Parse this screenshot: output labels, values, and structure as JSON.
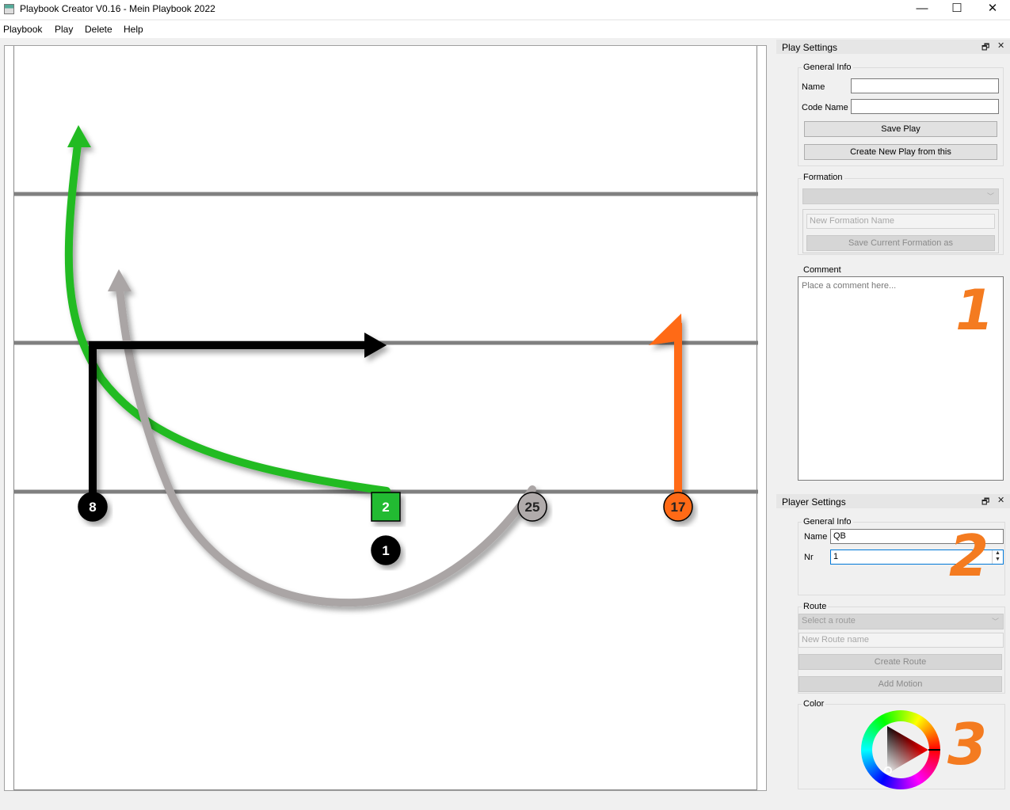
{
  "window": {
    "title": "Playbook Creator V0.16 - Mein Playbook 2022",
    "minimize": "—",
    "maximize": "☐",
    "close": "✕"
  },
  "menu": [
    "Playbook",
    "Play",
    "Delete",
    "Help"
  ],
  "field": {
    "yard_lines": 3,
    "players": [
      {
        "label": "8",
        "shape": "circle",
        "color": "#000000",
        "text_color": "#ffffff"
      },
      {
        "label": "2",
        "shape": "square",
        "color": "#22bb33",
        "text_color": "#ffffff"
      },
      {
        "label": "25",
        "shape": "circle",
        "color": "#b0abab",
        "text_color": "#222222"
      },
      {
        "label": "17",
        "shape": "circle",
        "color": "#ff6a13",
        "text_color": "#222222"
      },
      {
        "label": "1",
        "shape": "circle",
        "color": "#000000",
        "text_color": "#ffffff"
      }
    ],
    "route_colors": {
      "black": "#000000",
      "green": "#22bb22",
      "gray": "#aaa5a5",
      "orange": "#ff6a13"
    }
  },
  "play_settings": {
    "panel_title": "Play Settings",
    "float_icon": "🗗",
    "close_icon": "✕",
    "general_info": "General Info",
    "name_label": "Name",
    "name_value": "",
    "code_name_label": "Code Name",
    "code_name_value": "",
    "save_play": "Save Play",
    "create_new_play": "Create New Play from this",
    "formation_label": "Formation",
    "formation_selected": "",
    "new_formation_placeholder": "New Formation Name",
    "save_formation": "Save Current Formation as",
    "comment_label": "Comment",
    "comment_placeholder": "Place a comment here..."
  },
  "player_settings": {
    "panel_title": "Player Settings",
    "float_icon": "🗗",
    "close_icon": "✕",
    "general_info": "General Info",
    "name_label": "Name",
    "name_value": "QB",
    "nr_label": "Nr",
    "nr_value": "1",
    "route_label": "Route",
    "route_placeholder": "Select a route",
    "new_route_placeholder": "New Route name",
    "create_route": "Create Route",
    "add_motion": "Add Motion",
    "color_label": "Color"
  },
  "annotations": [
    "1",
    "2",
    "3"
  ],
  "accent_color": "#f47b20"
}
